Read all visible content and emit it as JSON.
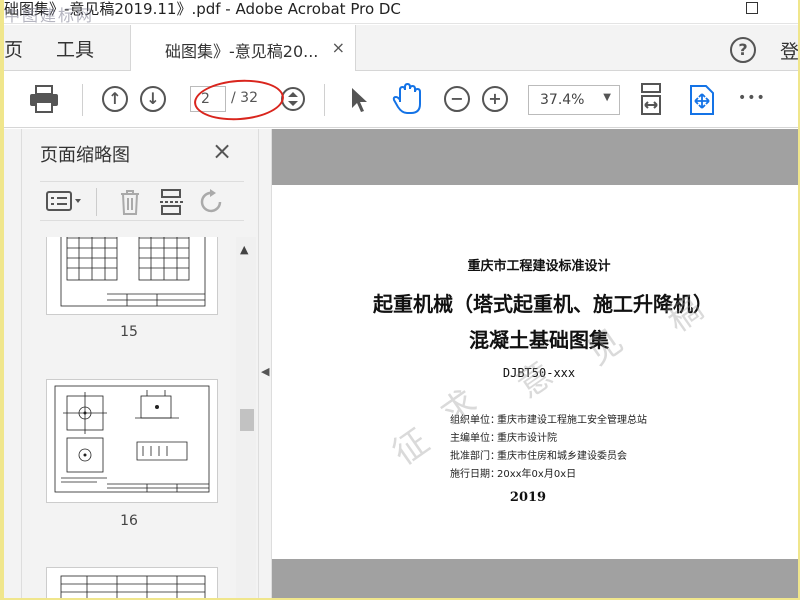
{
  "window": {
    "title": "础图集》-意见稿2019.11》.pdf - Adobe Acrobat Pro DC",
    "watermark": "中图建标网"
  },
  "menubar": {
    "items": [
      "页",
      "工具"
    ]
  },
  "tab": {
    "label": "础图集》-意见稿20...",
    "close": "×"
  },
  "header": {
    "help": "?",
    "login": "登"
  },
  "toolbar": {
    "page_current": "2",
    "page_total": "/ 32",
    "zoom": "37.4%",
    "more": "•••"
  },
  "side_panel": {
    "title": "页面缩略图",
    "close": "×",
    "thumbnails": [
      {
        "page": "15"
      },
      {
        "page": "16"
      }
    ]
  },
  "document": {
    "org_line": "重庆市工程建设标准设计",
    "title_line1": "起重机械（塔式起重机、施工升降机）",
    "title_line2": "混凝土基础图集",
    "code": "DJBT50-xxx",
    "info": [
      {
        "key": "组织单位：",
        "value": "重庆市建设工程施工安全管理总站"
      },
      {
        "key": "主编单位：",
        "value": "重庆市设计院"
      },
      {
        "key": "批准部门：",
        "value": "重庆市住房和城乡建设委员会"
      },
      {
        "key": "施行日期：",
        "value": "20xx年0x月0x日"
      }
    ],
    "year": "2019",
    "watermark": [
      "征",
      "求",
      "意",
      "见",
      "稿"
    ]
  },
  "colors": {
    "accent": "#1473e6",
    "annotation": "#d9251d",
    "page_gap": "#a1a1a1"
  }
}
